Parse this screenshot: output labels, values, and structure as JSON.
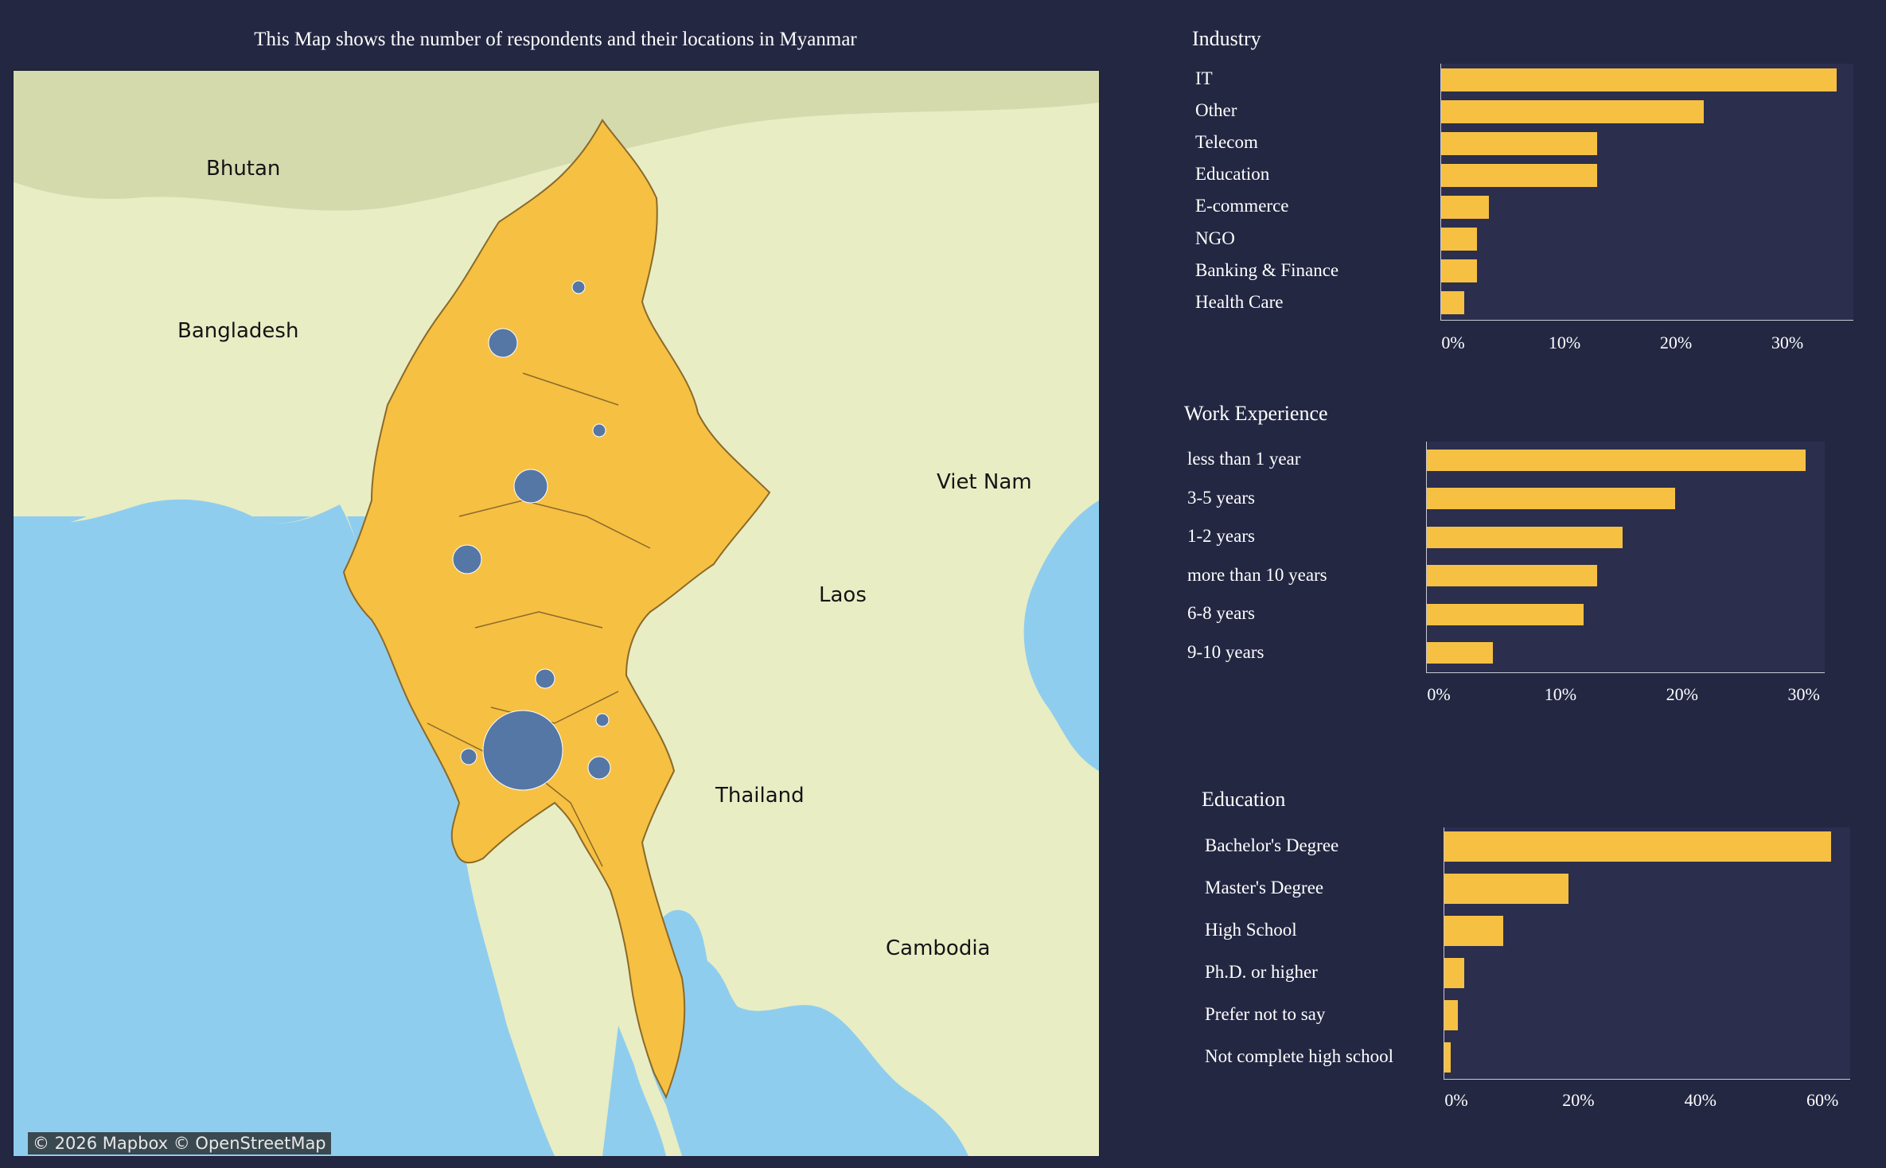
{
  "map": {
    "title": "This Map shows the number of respondents and their locations in Myanmar",
    "labels": {
      "bhutan": "Bhutan",
      "bangladesh": "Bangladesh",
      "vietnam": "Viet Nam",
      "laos": "Laos",
      "thailand": "Thailand",
      "cambodia": "Cambodia"
    },
    "attribution": "© 2026 Mapbox  © OpenStreetMap",
    "colors": {
      "sea": "#8fcdee",
      "land": "#e8edc4",
      "myanmar": "#f6c043",
      "bubble": "#5577a6"
    }
  },
  "chart_data": [
    {
      "type": "bar",
      "orientation": "horizontal",
      "title": "Industry",
      "categories": [
        "IT",
        "Other",
        "Telecom",
        "Education",
        "E-commerce",
        "NGO",
        "Banking & Finance",
        "Health Care"
      ],
      "values": [
        35.5,
        23.6,
        14,
        14,
        4.3,
        3.2,
        3.2,
        2.1
      ],
      "unit": "%",
      "xlim": [
        0,
        37
      ],
      "ticks": [
        0,
        10,
        20,
        30
      ],
      "tick_labels": [
        "0%",
        "10%",
        "20%",
        "30%"
      ]
    },
    {
      "type": "bar",
      "orientation": "horizontal",
      "title": "Work Experience",
      "categories": [
        "less than 1 year",
        "3-5 years",
        "1-2 years",
        "more than 10 years",
        "6-8 years",
        "9-10 years"
      ],
      "values": [
        31.1,
        20.4,
        16.1,
        14,
        12.9,
        5.4
      ],
      "unit": "%",
      "xlim": [
        0,
        32.7
      ],
      "ticks": [
        0,
        10,
        20,
        30
      ],
      "tick_labels": [
        "0%",
        "10%",
        "20%",
        "30%"
      ]
    },
    {
      "type": "bar",
      "orientation": "horizontal",
      "title": "Education",
      "categories": [
        "Bachelor's Degree",
        "Master's Degree",
        "High School",
        "Ph.D. or higher",
        "Prefer not to say",
        "Not complete high school"
      ],
      "values": [
        63.4,
        20.4,
        9.7,
        3.2,
        2.2,
        1.1
      ],
      "unit": "%",
      "xlim": [
        0,
        66.5
      ],
      "ticks": [
        0,
        20,
        40,
        60
      ],
      "tick_labels": [
        "0%",
        "20%",
        "40%",
        "60%"
      ]
    }
  ],
  "colors": {
    "background": "#232742",
    "plot_bg": "#2b2e4d",
    "bar": "#f6c043"
  }
}
